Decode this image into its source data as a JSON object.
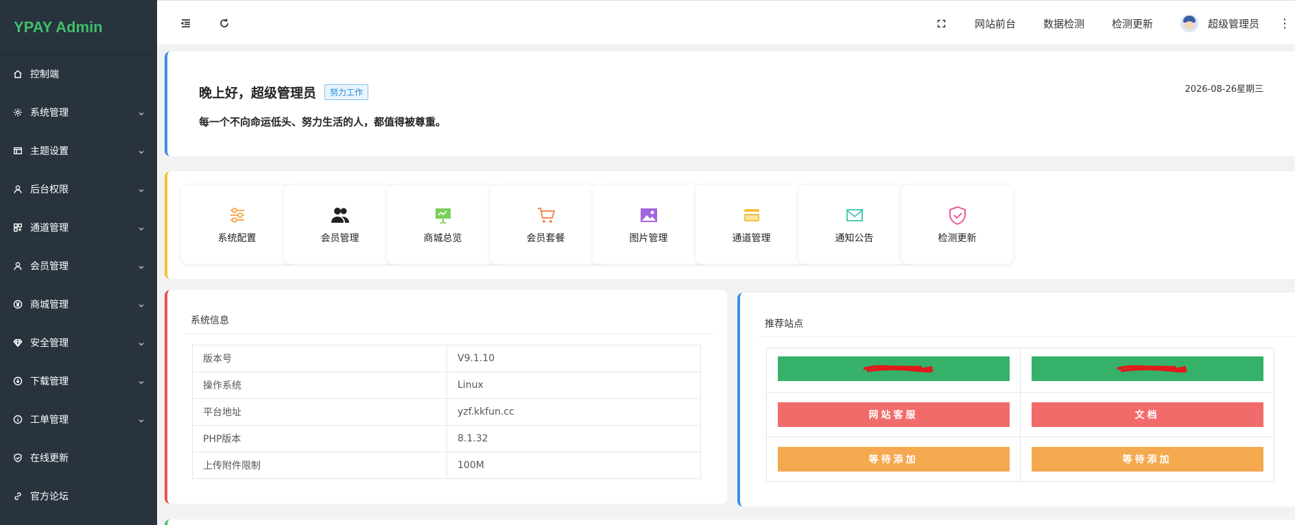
{
  "app": {
    "logo": "YPAY Admin"
  },
  "sidebar": {
    "items": [
      {
        "label": "控制端",
        "icon": "home-icon",
        "expandable": false
      },
      {
        "label": "系统管理",
        "icon": "gear-icon",
        "expandable": true
      },
      {
        "label": "主题设置",
        "icon": "layout-icon",
        "expandable": true
      },
      {
        "label": "后台权限",
        "icon": "user-icon",
        "expandable": true
      },
      {
        "label": "通道管理",
        "icon": "apps-icon",
        "expandable": true
      },
      {
        "label": "会员管理",
        "icon": "user-icon",
        "expandable": true
      },
      {
        "label": "商城管理",
        "icon": "yen-icon",
        "expandable": true
      },
      {
        "label": "安全管理",
        "icon": "diamond-icon",
        "expandable": true
      },
      {
        "label": "下载管理",
        "icon": "download-icon",
        "expandable": true
      },
      {
        "label": "工单管理",
        "icon": "info-icon",
        "expandable": true
      },
      {
        "label": "在线更新",
        "icon": "shield-check-icon",
        "expandable": false
      },
      {
        "label": "官方论坛",
        "icon": "link-icon",
        "expandable": false
      }
    ]
  },
  "header": {
    "links": [
      "网站前台",
      "数据检测",
      "检测更新"
    ],
    "user": "超级管理员"
  },
  "welcome": {
    "greeting": "晚上好，超级管理员",
    "tag": "努力工作",
    "motto": "每一个不向命运低头、努力生活的人，都值得被尊重。",
    "date": "2026-08-26星期三"
  },
  "shortcuts": [
    {
      "label": "系统配置",
      "icon": "sliders-icon",
      "color": "#f5a94f"
    },
    {
      "label": "会员管理",
      "icon": "users-icon",
      "color": "#222222"
    },
    {
      "label": "商城总览",
      "icon": "presentation-icon",
      "color": "#7ccd5a"
    },
    {
      "label": "会员套餐",
      "icon": "cart-icon",
      "color": "#f5874f"
    },
    {
      "label": "图片管理",
      "icon": "image-icon",
      "color": "#a066e0"
    },
    {
      "label": "通道管理",
      "icon": "card-icon",
      "color": "#f5c042"
    },
    {
      "label": "通知公告",
      "icon": "mail-icon",
      "color": "#4fc9b4"
    },
    {
      "label": "检测更新",
      "icon": "shield-check-icon",
      "color": "#e85a9a"
    }
  ],
  "sysinfo": {
    "title": "系统信息",
    "rows": [
      {
        "key": "版本号",
        "value": "V9.1.10"
      },
      {
        "key": "操作系统",
        "value": "Linux"
      },
      {
        "key": "平台地址",
        "value": "yzf.kkfun.cc"
      },
      {
        "key": "PHP版本",
        "value": "8.1.32"
      },
      {
        "key": "上传附件限制",
        "value": "100M"
      }
    ]
  },
  "recommend": {
    "title": "推荐站点",
    "buttons": [
      {
        "label": "",
        "color": "green",
        "redacted": true
      },
      {
        "label": "",
        "color": "green",
        "redacted": true
      },
      {
        "label": "网站客服",
        "color": "red"
      },
      {
        "label": "文档",
        "color": "red"
      },
      {
        "label": "等待添加",
        "color": "orange"
      },
      {
        "label": "等待添加",
        "color": "orange"
      }
    ]
  }
}
